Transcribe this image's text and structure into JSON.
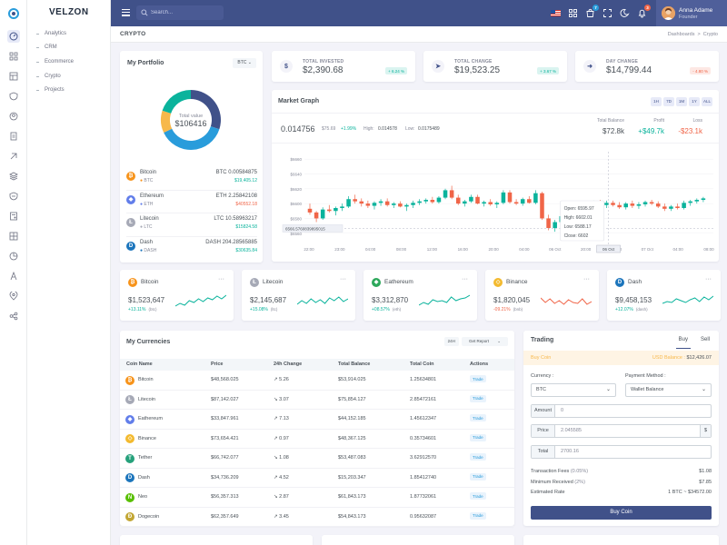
{
  "brand": "VELZON",
  "nav": {
    "items": [
      "Analytics",
      "CRM",
      "Ecommerce",
      "Crypto",
      "Projects"
    ]
  },
  "topbar": {
    "search_placeholder": "Search...",
    "cart_badge": "7",
    "bell_badge": "3",
    "user_name": "Anna Adame",
    "user_role": "Founder"
  },
  "page": {
    "title": "CRYPTO",
    "breadcrumb": [
      "Dashboards",
      ">",
      "Crypto"
    ]
  },
  "portfolio": {
    "title": "My Portfolio",
    "select": "BTC",
    "total_label": "Total value",
    "total_value": "$106416",
    "rows": [
      {
        "name": "Bitcoin",
        "sym": "BTC",
        "amount": "BTC 0.00584875",
        "usd": "$19,405.12",
        "color": "#f7931a",
        "glyph": "₿",
        "usd_color": "#0ab39c"
      },
      {
        "name": "Ethereum",
        "sym": "ETH",
        "amount": "ETH 2.25842108",
        "usd": "$40552.18",
        "color": "#627eea",
        "glyph": "◆",
        "usd_color": "#f06548"
      },
      {
        "name": "Litecoin",
        "sym": "LTC",
        "amount": "LTC 10.58963217",
        "usd": "$15824.58",
        "color": "#a6a9b6",
        "glyph": "Ł",
        "usd_color": "#0ab39c"
      },
      {
        "name": "Dash",
        "sym": "DASH",
        "amount": "DASH 204.28565885",
        "usd": "$30635.84",
        "color": "#1c75bc",
        "glyph": "D",
        "usd_color": "#0ab39c"
      }
    ]
  },
  "stats": [
    {
      "label": "TOTAL INVESTED",
      "value": "$2,390.68",
      "pct": "+ 6.24 %",
      "up": true
    },
    {
      "label": "TOTAL CHANGE",
      "value": "$19,523.25",
      "pct": "+ 3.67 %",
      "up": true
    },
    {
      "label": "DAY CHANGE",
      "value": "$14,799.44",
      "pct": "- 4.80 %",
      "up": false
    }
  ],
  "market": {
    "title": "Market Graph",
    "ranges": [
      "1H",
      "7D",
      "1M",
      "1Y",
      "ALL"
    ],
    "price": "0.014756",
    "usd": "$75.69",
    "change": "+1.99%",
    "high_label": "High:",
    "high": "0.014578",
    "low_label": "Low:",
    "low": "0.0175489",
    "kpis": [
      {
        "label": "Total Balance",
        "value": "$72.8k",
        "color": "#495057"
      },
      {
        "label": "Profit",
        "value": "+$49.7k",
        "color": "#0ab39c"
      },
      {
        "label": "Loss",
        "value": "-$23.1k",
        "color": "#f06548"
      }
    ],
    "y_ticks": [
      "$6660",
      "$6640",
      "$6620",
      "$6600",
      "$6580",
      "$6560"
    ],
    "x_ticks": [
      "22:00",
      "23:00",
      "04:00",
      "08:00",
      "12:00",
      "16:00",
      "20:00",
      "04:00",
      "06 Oct",
      "20:00",
      "22:00",
      "07 Oct",
      "04:00",
      "08:00"
    ],
    "crosshair_y": "6566.5760839895015",
    "crosshair_x": "06 Oct",
    "tooltip": {
      "open": "Open: 6595.97",
      "high": "High: 6602.01",
      "low": "Low: 6588.17",
      "close": "Close: 6602"
    }
  },
  "chart_data": {
    "type": "candlestick",
    "ylim": [
      6545,
      6670
    ],
    "candles": [
      [
        6593,
        6600,
        6585,
        6588
      ],
      [
        6588,
        6590,
        6575,
        6580
      ],
      [
        6580,
        6595,
        6578,
        6592
      ],
      [
        6592,
        6598,
        6588,
        6590
      ],
      [
        6590,
        6596,
        6584,
        6594
      ],
      [
        6594,
        6600,
        6590,
        6596
      ],
      [
        6596,
        6610,
        6594,
        6606
      ],
      [
        6606,
        6612,
        6600,
        6603
      ],
      [
        6603,
        6607,
        6596,
        6600
      ],
      [
        6600,
        6604,
        6594,
        6597
      ],
      [
        6597,
        6603,
        6592,
        6601
      ],
      [
        6601,
        6606,
        6597,
        6603
      ],
      [
        6603,
        6607,
        6596,
        6598
      ],
      [
        6598,
        6602,
        6594,
        6600
      ],
      [
        6600,
        6603,
        6595,
        6596
      ],
      [
        6596,
        6600,
        6590,
        6598
      ],
      [
        6598,
        6604,
        6594,
        6601
      ],
      [
        6601,
        6606,
        6598,
        6603
      ],
      [
        6603,
        6607,
        6600,
        6605
      ],
      [
        6605,
        6609,
        6600,
        6602
      ],
      [
        6602,
        6610,
        6600,
        6608
      ],
      [
        6608,
        6620,
        6606,
        6618
      ],
      [
        6618,
        6624,
        6606,
        6608
      ],
      [
        6608,
        6612,
        6598,
        6600
      ],
      [
        6600,
        6605,
        6596,
        6603
      ],
      [
        6603,
        6612,
        6601,
        6609
      ],
      [
        6609,
        6612,
        6599,
        6600
      ],
      [
        6600,
        6604,
        6596,
        6602
      ],
      [
        6602,
        6606,
        6597,
        6599
      ],
      [
        6599,
        6603,
        6594,
        6601
      ],
      [
        6601,
        6618,
        6599,
        6615
      ],
      [
        6615,
        6618,
        6600,
        6602
      ],
      [
        6602,
        6606,
        6598,
        6600
      ],
      [
        6600,
        6608,
        6597,
        6606
      ],
      [
        6606,
        6610,
        6600,
        6601
      ],
      [
        6601,
        6618,
        6599,
        6614
      ],
      [
        6614,
        6616,
        6578,
        6580
      ],
      [
        6580,
        6585,
        6564,
        6567
      ],
      [
        6567,
        6578,
        6562,
        6575
      ],
      [
        6575,
        6585,
        6570,
        6583
      ],
      [
        6583,
        6592,
        6580,
        6590
      ],
      [
        6590,
        6600,
        6586,
        6598
      ],
      [
        6598,
        6603,
        6590,
        6592
      ],
      [
        6592,
        6600,
        6588,
        6596
      ],
      [
        6596,
        6604,
        6593,
        6602
      ],
      [
        6602,
        6605,
        6596,
        6598
      ],
      [
        6598,
        6604,
        6594,
        6601
      ],
      [
        6601,
        6604,
        6596,
        6598
      ],
      [
        6598,
        6602,
        6593,
        6595
      ],
      [
        6595,
        6602,
        6592,
        6600
      ],
      [
        6600,
        6604,
        6594,
        6597
      ],
      [
        6597,
        6602,
        6593,
        6599
      ],
      [
        6599,
        6604,
        6596,
        6602
      ],
      [
        6602,
        6605,
        6598,
        6600
      ],
      [
        6600,
        6603,
        6594,
        6596
      ],
      [
        6596,
        6600,
        6590,
        6593
      ],
      [
        6593,
        6598,
        6590,
        6596
      ],
      [
        6596,
        6600,
        6592,
        6594
      ],
      [
        6594,
        6604,
        6592,
        6601
      ],
      [
        6601,
        6605,
        6597,
        6603
      ],
      [
        6603,
        6607,
        6600,
        6605
      ],
      [
        6605,
        6609,
        6602,
        6607
      ]
    ]
  },
  "coins": [
    {
      "name": "Bitcoin",
      "value": "$1,523,647",
      "pct": "+13.11%",
      "sym": "(btc)",
      "up": true,
      "color": "#f7931a",
      "glyph": "₿",
      "spark": [
        6,
        9,
        7,
        12,
        10,
        14,
        11,
        15,
        13,
        17,
        14,
        18
      ]
    },
    {
      "name": "Litecoin",
      "value": "$2,145,687",
      "pct": "+15.08%",
      "sym": "(ltc)",
      "up": true,
      "color": "#a6a9b6",
      "glyph": "Ł",
      "spark": [
        8,
        12,
        9,
        14,
        10,
        13,
        9,
        15,
        12,
        16,
        11,
        14
      ]
    },
    {
      "name": "Eathereum",
      "value": "$3,312,870",
      "pct": "+08.57%",
      "sym": "(eth)",
      "up": true,
      "color": "#2da85b",
      "glyph": "◆",
      "spark": [
        7,
        10,
        8,
        13,
        11,
        12,
        10,
        16,
        12,
        14,
        15,
        18
      ]
    },
    {
      "name": "Binance",
      "value": "$1,820,045",
      "pct": "-09.21%",
      "sym": "(bnb)",
      "up": false,
      "color": "#f3ba2f",
      "glyph": "◇",
      "spark": [
        15,
        10,
        14,
        9,
        12,
        8,
        13,
        10,
        9,
        14,
        8,
        11
      ]
    },
    {
      "name": "Dash",
      "value": "$9,458,153",
      "pct": "+12.07%",
      "sym": "(dash)",
      "up": true,
      "color": "#1c75bc",
      "glyph": "D",
      "spark": [
        9,
        11,
        10,
        14,
        12,
        10,
        13,
        15,
        11,
        16,
        13,
        17
      ]
    }
  ],
  "currencies": {
    "title": "My Currencies",
    "btn_24h": "24H",
    "btn_report": "Get Report",
    "headers": [
      "Coin Name",
      "Price",
      "24h Change",
      "Total Balance",
      "Total Coin",
      "Actions"
    ],
    "rows": [
      {
        "name": "Bitcoin",
        "price": "$48,568.025",
        "change": "5.26",
        "up": true,
        "balance": "$53,914.025",
        "coins": "1.25634801",
        "action": "Trade",
        "color": "#f7931a",
        "glyph": "₿"
      },
      {
        "name": "Litecoin",
        "price": "$87,142.027",
        "change": "3.07",
        "up": false,
        "balance": "$75,854.127",
        "coins": "2.85472161",
        "action": "Trade",
        "color": "#a6a9b6",
        "glyph": "Ł"
      },
      {
        "name": "Eathereum",
        "price": "$33,847.961",
        "change": "7.13",
        "up": true,
        "balance": "$44,152.185",
        "coins": "1.45612347",
        "action": "Trade",
        "color": "#627eea",
        "glyph": "◆"
      },
      {
        "name": "Binance",
        "price": "$73,654.421",
        "change": "0.97",
        "up": true,
        "balance": "$48,367.125",
        "coins": "0.35734601",
        "action": "Trade",
        "color": "#f3ba2f",
        "glyph": "◇"
      },
      {
        "name": "Tether",
        "price": "$66,742.077",
        "change": "1.08",
        "up": false,
        "balance": "$53,487.083",
        "coins": "3.62912570",
        "action": "Trade",
        "color": "#26a17b",
        "glyph": "T"
      },
      {
        "name": "Dash",
        "price": "$34,736.209",
        "change": "4.52",
        "up": true,
        "balance": "$15,203.347",
        "coins": "1.85412740",
        "action": "Trade",
        "color": "#1c75bc",
        "glyph": "D"
      },
      {
        "name": "Neo",
        "price": "$56,357.313",
        "change": "2.87",
        "up": false,
        "balance": "$61,843.173",
        "coins": "1.87732061",
        "action": "Trade",
        "color": "#58bf00",
        "glyph": "N"
      },
      {
        "name": "Dogecoin",
        "price": "$62,357.649",
        "change": "3.45",
        "up": true,
        "balance": "$54,843.173",
        "coins": "0.95632087",
        "action": "Trade",
        "color": "#c2a633",
        "glyph": "Ð"
      }
    ]
  },
  "trading": {
    "title": "Trading",
    "tab_buy": "Buy",
    "tab_sell": "Sell",
    "coin_label": "Buy Coin",
    "balance_label": "USD Balance :",
    "balance_value": "$12,426.07",
    "currency_label": "Currency :",
    "currency_value": "BTC",
    "payment_label": "Payment Method :",
    "payment_value": "Wallet Balance",
    "amount_label": "Amount",
    "amount_value": "0",
    "price_label": "Price",
    "price_value": "2.045585",
    "price_suffix": "$",
    "total_label": "Total",
    "total_value": "2700.16",
    "fee_label": "Transaction Fees",
    "fee_pct": "(0.05%)",
    "fee_value": "$1.08",
    "min_label": "Minimum Received",
    "min_pct": "(2%)",
    "min_value": "$7.85",
    "rate_label": "Estimated Rate",
    "rate_value": "1 BTC ~ $34572.00",
    "button": "Buy Coin"
  },
  "colors": {
    "primary": "#405189",
    "success": "#0ab39c",
    "danger": "#f06548",
    "warning": "#f7b84b",
    "info": "#299cdb"
  },
  "donut_segments": [
    {
      "name": "Bitcoin",
      "pct": 0.3,
      "color": "#405189"
    },
    {
      "name": "Ethereum",
      "pct": 0.38,
      "color": "#299cdb"
    },
    {
      "name": "Litecoin",
      "pct": 0.12,
      "color": "#f7b84b"
    },
    {
      "name": "Dash",
      "pct": 0.2,
      "color": "#0ab39c"
    }
  ]
}
